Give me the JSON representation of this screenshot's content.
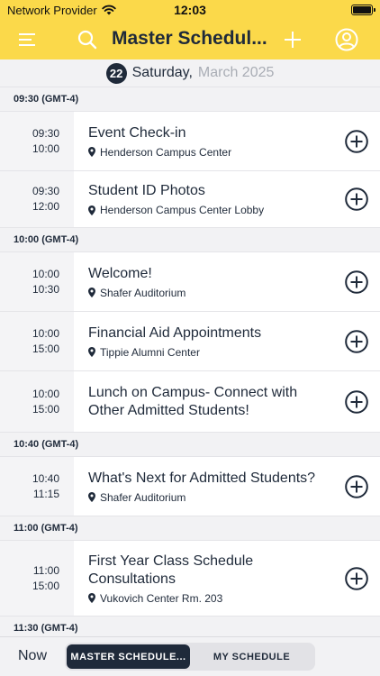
{
  "status_bar": {
    "carrier": "Network Provider",
    "time": "12:03"
  },
  "nav": {
    "title": "Master Schedul...",
    "menu_icon": "menu-icon",
    "search_icon": "search-icon",
    "add_icon": "plus-icon",
    "profile_icon": "user-icon"
  },
  "date_header": {
    "day": "22",
    "weekday": "Saturday,",
    "month": "March 2025"
  },
  "sections": [
    {
      "header": "09:30 (GMT-4)",
      "events": [
        {
          "start": "09:30",
          "end": "10:00",
          "title": "Event Check-in",
          "location": "Henderson Campus Center"
        },
        {
          "start": "09:30",
          "end": "12:00",
          "title": "Student ID Photos",
          "location": "Henderson Campus Center Lobby"
        }
      ]
    },
    {
      "header": "10:00 (GMT-4)",
      "events": [
        {
          "start": "10:00",
          "end": "10:30",
          "title": "Welcome!",
          "location": "Shafer Auditorium"
        },
        {
          "start": "10:00",
          "end": "15:00",
          "title": "Financial Aid Appointments",
          "location": "Tippie Alumni Center"
        },
        {
          "start": "10:00",
          "end": "15:00",
          "title": "Lunch on Campus- Connect with Other Admitted Students!",
          "location": ""
        }
      ]
    },
    {
      "header": "10:40 (GMT-4)",
      "events": [
        {
          "start": "10:40",
          "end": "11:15",
          "title": "What's Next for Admitted Students?",
          "location": "Shafer Auditorium"
        }
      ]
    },
    {
      "header": "11:00 (GMT-4)",
      "events": [
        {
          "start": "11:00",
          "end": "15:00",
          "title": "First Year Class Schedule Consultations",
          "location": "Vukovich Center Rm. 203"
        }
      ]
    },
    {
      "header": "11:30 (GMT-4)",
      "events": []
    }
  ],
  "tab_bar": {
    "now_label": "Now",
    "tabs": [
      "MASTER SCHEDULE...",
      "MY SCHEDULE"
    ],
    "active_tab": 0
  },
  "colors": {
    "accent": "#fbd94a",
    "navy": "#1f2a3a",
    "section_bg": "#f2f2f4"
  }
}
